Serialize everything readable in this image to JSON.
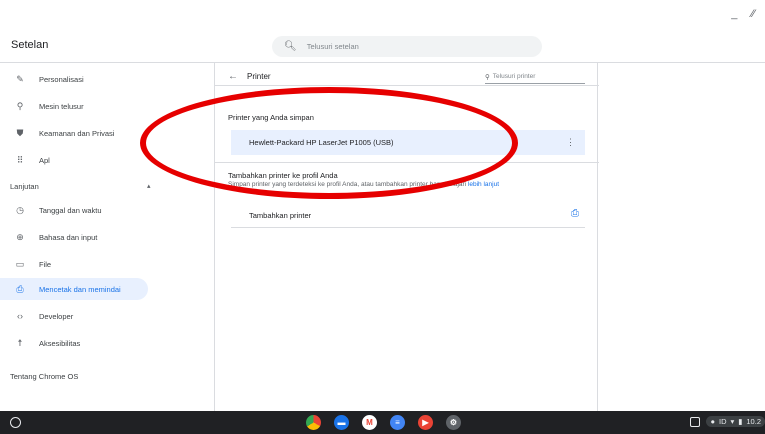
{
  "window": {
    "minimize": "_",
    "other": "⁄⁄"
  },
  "header": {
    "title": "Setelan",
    "search_placeholder": "Telusuri setelan"
  },
  "sidebar": {
    "items": [
      {
        "label": "Personalisasi",
        "icon": "pencil-icon"
      },
      {
        "label": "Mesin telusur",
        "icon": "search-icon"
      },
      {
        "label": "Keamanan dan Privasi",
        "icon": "shield-icon"
      },
      {
        "label": "Apl",
        "icon": "apps-grid-icon"
      }
    ],
    "advanced_label": "Lanjutan",
    "advanced_items": [
      {
        "label": "Tanggal dan waktu",
        "icon": "clock-icon"
      },
      {
        "label": "Bahasa dan input",
        "icon": "globe-icon"
      },
      {
        "label": "File",
        "icon": "folder-icon"
      },
      {
        "label": "Mencetak dan memindai",
        "icon": "printer-icon",
        "active": true
      },
      {
        "label": "Developer",
        "icon": "code-icon"
      },
      {
        "label": "Aksesibilitas",
        "icon": "accessibility-icon"
      }
    ],
    "about_label": "Tentang Chrome OS"
  },
  "panel": {
    "title": "Printer",
    "search_placeholder": "Telusuri printer",
    "saved_heading": "Printer yang Anda simpan",
    "saved_printer": "Hewlett-Packard HP LaserJet P1005 (USB)",
    "add_heading": "Tambahkan printer ke profil Anda",
    "add_desc_visible": "Simpan printer yang terdeteksi ke profil Anda, atau tambahkan printer baru ",
    "add_desc_obscured": "Pelajari",
    "add_desc_link": "lebih lanjut",
    "add_printer_label": "Tambahkan printer"
  },
  "shelf": {
    "apps": [
      {
        "name": "chrome-icon",
        "color": "#ea4335"
      },
      {
        "name": "files-icon",
        "color": "#1a73e8"
      },
      {
        "name": "gmail-icon",
        "color": "#4285f4"
      },
      {
        "name": "docs-icon",
        "color": "#4285f4"
      },
      {
        "name": "youtube-icon",
        "color": "#ea4335"
      },
      {
        "name": "settings-icon",
        "color": "#5f6368"
      }
    ],
    "tray_locale": "ID",
    "time": "10.2"
  },
  "colors": {
    "accent": "#1a73e8",
    "active_bg": "#e8f0fe",
    "annotation": "#e60000",
    "shelf": "#202124"
  }
}
